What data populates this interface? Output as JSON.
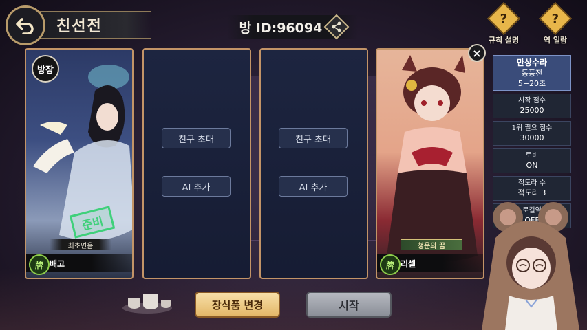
{
  "header": {
    "title": "친선전",
    "room_id": "방 ID:96094"
  },
  "top_buttons": {
    "rules_label": "규칙 설명",
    "yaku_label": "역 일람"
  },
  "players": [
    {
      "host_badge": "방장",
      "name": "배고",
      "title": "최초면음",
      "ready_stamp": "준비",
      "card_color": "#3d4f82"
    },
    {
      "slot_buttons": [
        "친구 초대",
        "AI 추가"
      ]
    },
    {
      "slot_buttons": [
        "친구 초대",
        "AI 추가"
      ]
    },
    {
      "name": "리셀",
      "title": "청운의 꿈",
      "card_color": "#e4a489"
    }
  ],
  "settings": {
    "mode": "만상수라",
    "match": "동풍전",
    "time": "5+20초",
    "rows": [
      {
        "label": "시작 점수",
        "value": "25000"
      },
      {
        "label": "1위 필요 점수",
        "value": "30000"
      },
      {
        "label": "토비",
        "value": "ON"
      },
      {
        "label": "적도라 수",
        "value": "적도라 3"
      },
      {
        "label": "로컬역",
        "value": "OFF"
      }
    ]
  },
  "bottom": {
    "decor_button": "장식품 변경",
    "start_button": "시작"
  },
  "colors": {
    "frame_gold": "#c39467",
    "ready_green": "#3fd07a",
    "settings_accent": "#3a4c7a"
  }
}
